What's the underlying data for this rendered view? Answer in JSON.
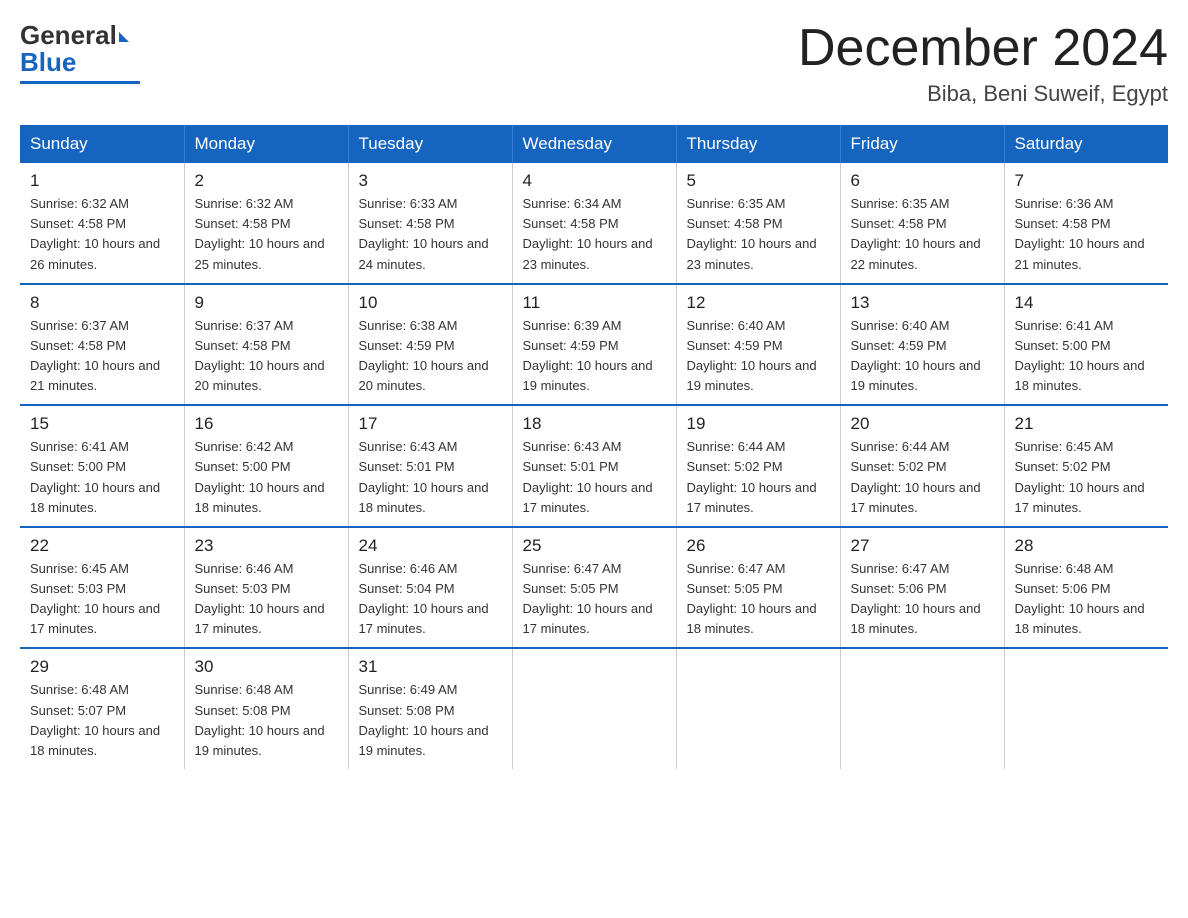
{
  "logo": {
    "general": "General",
    "blue": "Blue"
  },
  "header": {
    "month_title": "December 2024",
    "subtitle": "Biba, Beni Suweif, Egypt"
  },
  "days_of_week": [
    "Sunday",
    "Monday",
    "Tuesday",
    "Wednesday",
    "Thursday",
    "Friday",
    "Saturday"
  ],
  "weeks": [
    [
      {
        "day": "1",
        "sunrise": "Sunrise: 6:32 AM",
        "sunset": "Sunset: 4:58 PM",
        "daylight": "Daylight: 10 hours and 26 minutes."
      },
      {
        "day": "2",
        "sunrise": "Sunrise: 6:32 AM",
        "sunset": "Sunset: 4:58 PM",
        "daylight": "Daylight: 10 hours and 25 minutes."
      },
      {
        "day": "3",
        "sunrise": "Sunrise: 6:33 AM",
        "sunset": "Sunset: 4:58 PM",
        "daylight": "Daylight: 10 hours and 24 minutes."
      },
      {
        "day": "4",
        "sunrise": "Sunrise: 6:34 AM",
        "sunset": "Sunset: 4:58 PM",
        "daylight": "Daylight: 10 hours and 23 minutes."
      },
      {
        "day": "5",
        "sunrise": "Sunrise: 6:35 AM",
        "sunset": "Sunset: 4:58 PM",
        "daylight": "Daylight: 10 hours and 23 minutes."
      },
      {
        "day": "6",
        "sunrise": "Sunrise: 6:35 AM",
        "sunset": "Sunset: 4:58 PM",
        "daylight": "Daylight: 10 hours and 22 minutes."
      },
      {
        "day": "7",
        "sunrise": "Sunrise: 6:36 AM",
        "sunset": "Sunset: 4:58 PM",
        "daylight": "Daylight: 10 hours and 21 minutes."
      }
    ],
    [
      {
        "day": "8",
        "sunrise": "Sunrise: 6:37 AM",
        "sunset": "Sunset: 4:58 PM",
        "daylight": "Daylight: 10 hours and 21 minutes."
      },
      {
        "day": "9",
        "sunrise": "Sunrise: 6:37 AM",
        "sunset": "Sunset: 4:58 PM",
        "daylight": "Daylight: 10 hours and 20 minutes."
      },
      {
        "day": "10",
        "sunrise": "Sunrise: 6:38 AM",
        "sunset": "Sunset: 4:59 PM",
        "daylight": "Daylight: 10 hours and 20 minutes."
      },
      {
        "day": "11",
        "sunrise": "Sunrise: 6:39 AM",
        "sunset": "Sunset: 4:59 PM",
        "daylight": "Daylight: 10 hours and 19 minutes."
      },
      {
        "day": "12",
        "sunrise": "Sunrise: 6:40 AM",
        "sunset": "Sunset: 4:59 PM",
        "daylight": "Daylight: 10 hours and 19 minutes."
      },
      {
        "day": "13",
        "sunrise": "Sunrise: 6:40 AM",
        "sunset": "Sunset: 4:59 PM",
        "daylight": "Daylight: 10 hours and 19 minutes."
      },
      {
        "day": "14",
        "sunrise": "Sunrise: 6:41 AM",
        "sunset": "Sunset: 5:00 PM",
        "daylight": "Daylight: 10 hours and 18 minutes."
      }
    ],
    [
      {
        "day": "15",
        "sunrise": "Sunrise: 6:41 AM",
        "sunset": "Sunset: 5:00 PM",
        "daylight": "Daylight: 10 hours and 18 minutes."
      },
      {
        "day": "16",
        "sunrise": "Sunrise: 6:42 AM",
        "sunset": "Sunset: 5:00 PM",
        "daylight": "Daylight: 10 hours and 18 minutes."
      },
      {
        "day": "17",
        "sunrise": "Sunrise: 6:43 AM",
        "sunset": "Sunset: 5:01 PM",
        "daylight": "Daylight: 10 hours and 18 minutes."
      },
      {
        "day": "18",
        "sunrise": "Sunrise: 6:43 AM",
        "sunset": "Sunset: 5:01 PM",
        "daylight": "Daylight: 10 hours and 17 minutes."
      },
      {
        "day": "19",
        "sunrise": "Sunrise: 6:44 AM",
        "sunset": "Sunset: 5:02 PM",
        "daylight": "Daylight: 10 hours and 17 minutes."
      },
      {
        "day": "20",
        "sunrise": "Sunrise: 6:44 AM",
        "sunset": "Sunset: 5:02 PM",
        "daylight": "Daylight: 10 hours and 17 minutes."
      },
      {
        "day": "21",
        "sunrise": "Sunrise: 6:45 AM",
        "sunset": "Sunset: 5:02 PM",
        "daylight": "Daylight: 10 hours and 17 minutes."
      }
    ],
    [
      {
        "day": "22",
        "sunrise": "Sunrise: 6:45 AM",
        "sunset": "Sunset: 5:03 PM",
        "daylight": "Daylight: 10 hours and 17 minutes."
      },
      {
        "day": "23",
        "sunrise": "Sunrise: 6:46 AM",
        "sunset": "Sunset: 5:03 PM",
        "daylight": "Daylight: 10 hours and 17 minutes."
      },
      {
        "day": "24",
        "sunrise": "Sunrise: 6:46 AM",
        "sunset": "Sunset: 5:04 PM",
        "daylight": "Daylight: 10 hours and 17 minutes."
      },
      {
        "day": "25",
        "sunrise": "Sunrise: 6:47 AM",
        "sunset": "Sunset: 5:05 PM",
        "daylight": "Daylight: 10 hours and 17 minutes."
      },
      {
        "day": "26",
        "sunrise": "Sunrise: 6:47 AM",
        "sunset": "Sunset: 5:05 PM",
        "daylight": "Daylight: 10 hours and 18 minutes."
      },
      {
        "day": "27",
        "sunrise": "Sunrise: 6:47 AM",
        "sunset": "Sunset: 5:06 PM",
        "daylight": "Daylight: 10 hours and 18 minutes."
      },
      {
        "day": "28",
        "sunrise": "Sunrise: 6:48 AM",
        "sunset": "Sunset: 5:06 PM",
        "daylight": "Daylight: 10 hours and 18 minutes."
      }
    ],
    [
      {
        "day": "29",
        "sunrise": "Sunrise: 6:48 AM",
        "sunset": "Sunset: 5:07 PM",
        "daylight": "Daylight: 10 hours and 18 minutes."
      },
      {
        "day": "30",
        "sunrise": "Sunrise: 6:48 AM",
        "sunset": "Sunset: 5:08 PM",
        "daylight": "Daylight: 10 hours and 19 minutes."
      },
      {
        "day": "31",
        "sunrise": "Sunrise: 6:49 AM",
        "sunset": "Sunset: 5:08 PM",
        "daylight": "Daylight: 10 hours and 19 minutes."
      },
      null,
      null,
      null,
      null
    ]
  ]
}
